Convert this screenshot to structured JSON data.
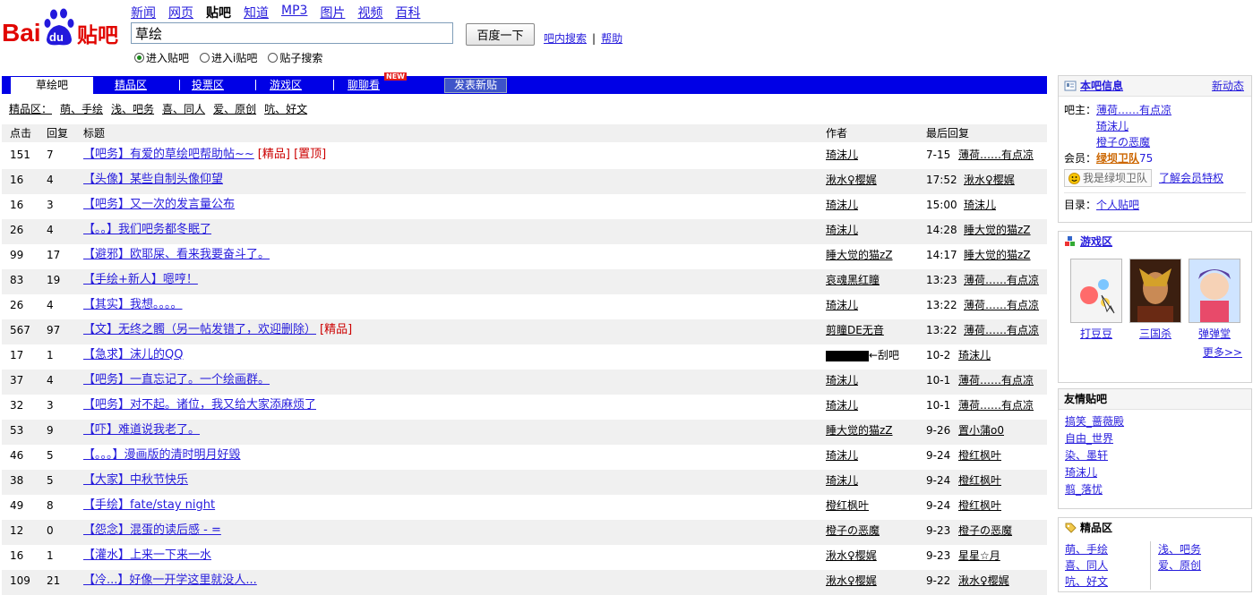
{
  "header": {
    "logo_text": "Bai du 贴吧",
    "nav": [
      "新闻",
      "网页",
      "贴吧",
      "知道",
      "MP3",
      "图片",
      "视频",
      "百科"
    ],
    "nav_current": "贴吧",
    "search_value": "草绘",
    "search_button": "百度一下",
    "link_in_bar_search": "吧内搜索",
    "link_help": "帮助",
    "link_sep": "|",
    "radios": [
      {
        "label": "进入贴吧",
        "checked": true
      },
      {
        "label": "进入i贴吧",
        "checked": false
      },
      {
        "label": "贴子搜索",
        "checked": false
      }
    ]
  },
  "tabs": {
    "active": "草绘吧",
    "items": [
      "精品区",
      "投票区",
      "游戏区",
      "聊聊看"
    ],
    "new_badge": "NEW",
    "post_button": "发表新贴"
  },
  "filter": {
    "label": "精品区：",
    "items": [
      "萌、手绘",
      "浅、吧务",
      "喜、同人",
      "爱、原创",
      "吭、好文"
    ]
  },
  "table": {
    "headers": {
      "clicks": "点击",
      "replies": "回复",
      "title": "标题",
      "author": "作者",
      "last": "最后回复"
    },
    "rows": [
      {
        "clicks": "151",
        "replies": "7",
        "title": "【吧务】有爱的草绘吧帮助帖~~",
        "tags": "[精品] [置顶]",
        "author": "琦沫儿",
        "time": "7-15",
        "last": "薄荷……有点凉"
      },
      {
        "clicks": "16",
        "replies": "4",
        "title": "【头像】某些自制头像仰望",
        "tags": "",
        "author": "湫水♀樱娓",
        "time": "17:52",
        "last": "湫水♀樱娓"
      },
      {
        "clicks": "16",
        "replies": "3",
        "title": "【吧务】又一次的发言量公布",
        "tags": "",
        "author": "琦沫儿",
        "time": "15:00",
        "last": "琦沫儿"
      },
      {
        "clicks": "26",
        "replies": "4",
        "title": "【。。】我们吧务都冬眠了",
        "tags": "",
        "author": "琦沫儿",
        "time": "14:28",
        "last": "睡大觉的猫zZ"
      },
      {
        "clicks": "99",
        "replies": "17",
        "title": "【避邪】欧耶屎、看来我要奋斗了。",
        "tags": "",
        "author": "睡大觉的猫zZ",
        "time": "14:17",
        "last": "睡大觉的猫zZ"
      },
      {
        "clicks": "83",
        "replies": "19",
        "title": "【手绘+新人】嗯哼！",
        "tags": "",
        "author": "哀魂黑红瞳",
        "time": "13:23",
        "last": "薄荷……有点凉"
      },
      {
        "clicks": "26",
        "replies": "4",
        "title": "【其实】我想。。。。",
        "tags": "",
        "author": "琦沫儿",
        "time": "13:22",
        "last": "薄荷……有点凉"
      },
      {
        "clicks": "567",
        "replies": "97",
        "title": "【文】无终之髑（另一帖发错了，欢迎删除）",
        "tags": "[精品]",
        "author": "剪瞳DE无音",
        "time": "13:22",
        "last": "薄荷……有点凉"
      },
      {
        "clicks": "17",
        "replies": "1",
        "title": "【急求】沫儿的QQ",
        "tags": "",
        "author": "←刮吧",
        "time": "10-2",
        "last": "琦沫儿"
      },
      {
        "clicks": "37",
        "replies": "4",
        "title": "【吧务】一直忘记了。一个绘画群。",
        "tags": "",
        "author": "琦沫儿",
        "time": "10-1",
        "last": "薄荷……有点凉"
      },
      {
        "clicks": "32",
        "replies": "3",
        "title": "【吧务】对不起。诸位，我又给大家添麻烦了",
        "tags": "",
        "author": "琦沫儿",
        "time": "10-1",
        "last": "薄荷……有点凉"
      },
      {
        "clicks": "53",
        "replies": "9",
        "title": "【吓】难道说我老了。",
        "tags": "",
        "author": "睡大觉的猫zZ",
        "time": "9-26",
        "last": "置小蒲o0"
      },
      {
        "clicks": "46",
        "replies": "5",
        "title": "【。。。】漫画版的清时明月好毁",
        "tags": "",
        "author": "琦沫儿",
        "time": "9-24",
        "last": "橙红枫叶"
      },
      {
        "clicks": "38",
        "replies": "5",
        "title": "【大家】中秋节快乐",
        "tags": "",
        "author": "琦沫儿",
        "time": "9-24",
        "last": "橙红枫叶"
      },
      {
        "clicks": "49",
        "replies": "8",
        "title": "【手绘】fate/stay night",
        "tags": "",
        "author": "橙红枫叶",
        "time": "9-24",
        "last": "橙红枫叶"
      },
      {
        "clicks": "12",
        "replies": "0",
        "title": "【怨念】混蛋的读后感 - =",
        "tags": "",
        "author": "橙子の恶魔",
        "time": "9-23",
        "last": "橙子の恶魔"
      },
      {
        "clicks": "16",
        "replies": "1",
        "title": "【灌水】上来一下来一水",
        "tags": "",
        "author": "湫水♀樱娓",
        "time": "9-23",
        "last": "星星☆月"
      },
      {
        "clicks": "109",
        "replies": "21",
        "title": "【冷...】好像一开学这里就没人...",
        "tags": "",
        "author": "湫水♀樱娓",
        "time": "9-22",
        "last": "湫水♀樱娓"
      }
    ]
  },
  "sidebar": {
    "info": {
      "title": "本吧信息",
      "news": "新动态",
      "owner_label": "吧主：",
      "owners": [
        "薄荷……有点凉",
        "琦沫儿",
        "橙子の恶魔"
      ],
      "member_label": "会员：",
      "member_group": "绿坝卫队",
      "member_count": "75",
      "join_button": "我是绿坝卫队",
      "privilege_link": "了解会员特权",
      "dir_label": "目录：",
      "dir_link": "个人贴吧"
    },
    "games": {
      "title": "游戏区",
      "items": [
        "打豆豆",
        "三国杀",
        "弹弹堂"
      ],
      "more": "更多>>"
    },
    "friends": {
      "title": "友情贴吧",
      "items": [
        "搞笑_蔷薇殿",
        "自由_世界",
        "染、墨轩",
        "琦沫儿",
        "翦_落忧"
      ]
    },
    "jingpin": {
      "title": "精品区",
      "col1": [
        "萌、手绘",
        "喜、同人",
        "吭、好文"
      ],
      "col2": [
        "浅、吧务",
        "爱、原创"
      ]
    }
  },
  "colors": {
    "tabbar": "#0000e6",
    "link": "#261cdc",
    "tag_red": "#cc0000",
    "row_alt": "#f0f0f0"
  }
}
